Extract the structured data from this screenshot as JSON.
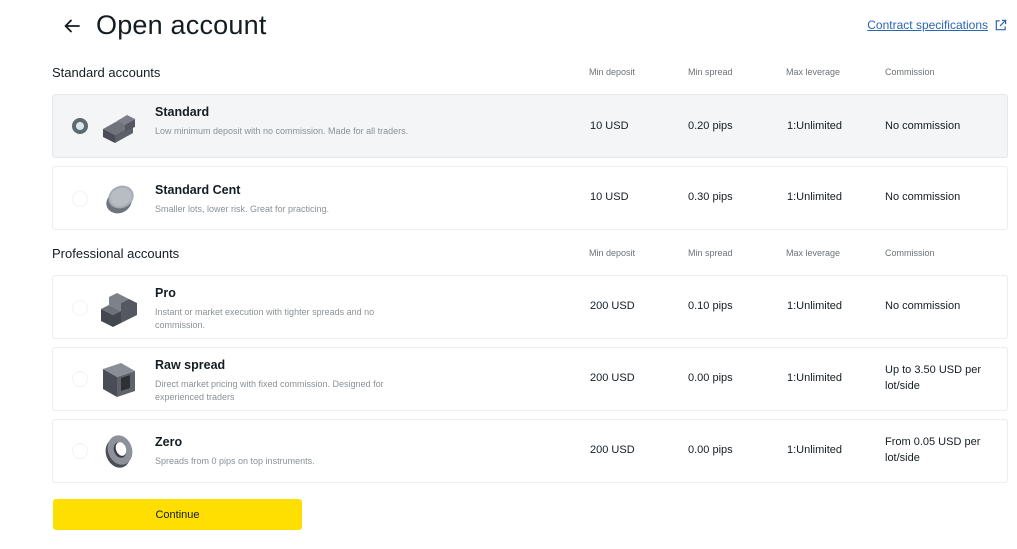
{
  "header": {
    "title": "Open account",
    "contract_link": "Contract specifications"
  },
  "columns": {
    "min_deposit": "Min deposit",
    "min_spread": "Min spread",
    "max_leverage": "Max leverage",
    "commission": "Commission"
  },
  "standard_section": {
    "title": "Standard accounts",
    "accounts": [
      {
        "name": "Standard",
        "description": "Low minimum deposit with no commission. Made for all traders.",
        "min_deposit": "10 USD",
        "min_spread": "0.20 pips",
        "max_leverage": "1:Unlimited",
        "commission": "No commission",
        "selected": true,
        "icon": "standard-block-icon"
      },
      {
        "name": "Standard Cent",
        "description": "Smaller lots, lower risk. Great for practicing.",
        "min_deposit": "10 USD",
        "min_spread": "0.30 pips",
        "max_leverage": "1:Unlimited",
        "commission": "No commission",
        "selected": false,
        "icon": "coin-icon"
      }
    ]
  },
  "professional_section": {
    "title": "Professional accounts",
    "accounts": [
      {
        "name": "Pro",
        "description": "Instant or market execution with tighter spreads and no commission.",
        "min_deposit": "200 USD",
        "min_spread": "0.10 pips",
        "max_leverage": "1:Unlimited",
        "commission": "No commission",
        "selected": false,
        "icon": "stairs-block-icon"
      },
      {
        "name": "Raw spread",
        "description": "Direct market pricing with fixed commission. Designed for experienced traders",
        "min_deposit": "200 USD",
        "min_spread": "0.00 pips",
        "max_leverage": "1:Unlimited",
        "commission": "Up to 3.50 USD per lot/side",
        "selected": false,
        "icon": "frame-block-icon"
      },
      {
        "name": "Zero",
        "description": "Spreads from 0 pips on top instruments.",
        "min_deposit": "200 USD",
        "min_spread": "0.00 pips",
        "max_leverage": "1:Unlimited",
        "commission": "From 0.05 USD per lot/side",
        "selected": false,
        "icon": "ring-icon"
      }
    ]
  },
  "footer": {
    "continue_label": "Continue"
  },
  "colors": {
    "accent_button": "#ffde02",
    "link": "#2b66b0",
    "selected_row": "#f3f5f7",
    "text_primary": "#141d22",
    "text_secondary": "#8a9196"
  }
}
